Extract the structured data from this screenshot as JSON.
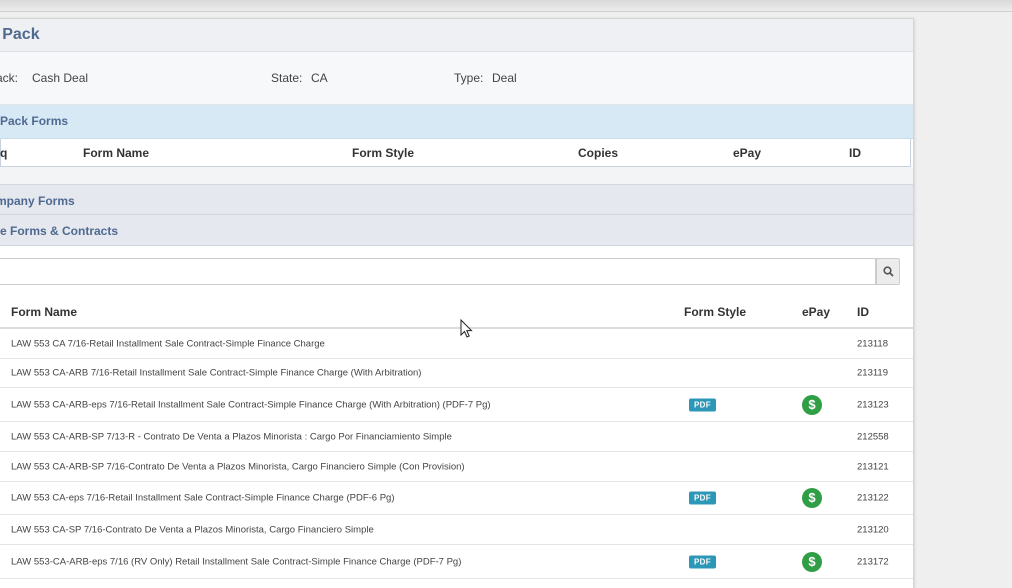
{
  "panel": {
    "title": "n Pack"
  },
  "meta": {
    "pack_label": "ack:",
    "pack_value": "Cash Deal",
    "state_label": "State:",
    "state_value": "CA",
    "type_label": "Type:",
    "type_value": "Deal"
  },
  "pack_forms": {
    "title": "Pack Forms",
    "columns": {
      "seq": "q",
      "form_name": "Form Name",
      "form_style": "Form Style",
      "copies": "Copies",
      "epay": "ePay",
      "id": "ID"
    }
  },
  "company_forms": {
    "title": "mpany Forms"
  },
  "state_forms": {
    "title": "te Forms & Contracts",
    "search": {
      "placeholder": ""
    },
    "columns": {
      "form_name": "Form Name",
      "form_style": "Form Style",
      "epay": "ePay",
      "id": "ID"
    },
    "rows": [
      {
        "name": "LAW 553 CA 7/16-Retail Installment Sale Contract-Simple Finance Charge",
        "style": "",
        "epay": false,
        "id": "213118"
      },
      {
        "name": "LAW 553 CA-ARB 7/16-Retail Installment Sale Contract-Simple Finance Charge (With Arbitration)",
        "style": "",
        "epay": false,
        "id": "213119"
      },
      {
        "name": "LAW 553 CA-ARB-eps 7/16-Retail Installment Sale Contract-Simple Finance Charge (With Arbitration) (PDF-7 Pg)",
        "style": "PDF",
        "epay": true,
        "id": "213123"
      },
      {
        "name": "LAW 553 CA-ARB-SP 7/13-R - Contrato De Venta a Plazos Minorista : Cargo Por Financiamiento Simple",
        "style": "",
        "epay": false,
        "id": "212558"
      },
      {
        "name": "LAW 553 CA-ARB-SP 7/16-Contrato De Venta a Plazos Minorista, Cargo Financiero Simple (Con Provision)",
        "style": "",
        "epay": false,
        "id": "213121"
      },
      {
        "name": "LAW 553 CA-eps 7/16-Retail Installment Sale Contract-Simple Finance Charge (PDF-6 Pg)",
        "style": "PDF",
        "epay": true,
        "id": "213122"
      },
      {
        "name": "LAW 553 CA-SP 7/16-Contrato De Venta a Plazos Minorista, Cargo Financiero Simple",
        "style": "",
        "epay": false,
        "id": "213120"
      },
      {
        "name": "LAW 553-CA-ARB-eps 7/16 (RV Only) Retail Installment Sale Contract-Simple Finance Charge (PDF-7 Pg)",
        "style": "PDF",
        "epay": true,
        "id": "213172"
      }
    ]
  },
  "icons": {
    "epay": "dollar-circle-icon",
    "search": "search-icon"
  },
  "colors": {
    "accent": "#4f6990",
    "pdf_badge": "#2c97b7",
    "epay": "#2f9e44"
  }
}
